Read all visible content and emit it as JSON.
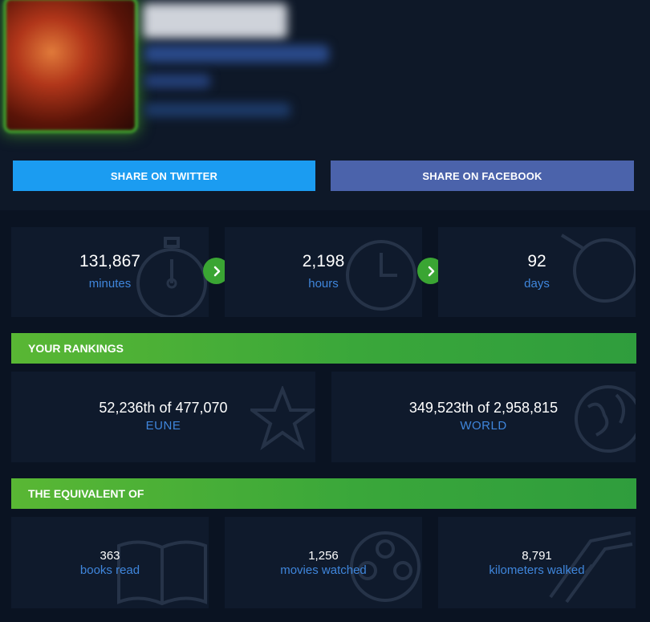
{
  "share": {
    "twitter_label": "SHARE ON TWITTER",
    "facebook_label": "SHARE ON FACEBOOK"
  },
  "time_stats": [
    {
      "value": "131,867",
      "unit": "minutes",
      "icon": "stopwatch-icon"
    },
    {
      "value": "2,198",
      "unit": "hours",
      "icon": "clock-icon"
    },
    {
      "value": "92",
      "unit": "days",
      "icon": "calendar-icon"
    }
  ],
  "rankings": {
    "title": "YOUR RANKINGS",
    "items": [
      {
        "value": "52,236th of 477,070",
        "label": "EUNE",
        "icon": "star-icon"
      },
      {
        "value": "349,523th of 2,958,815",
        "label": "WORLD",
        "icon": "globe-icon"
      }
    ]
  },
  "equivalent": {
    "title": "THE EQUIVALENT OF",
    "items": [
      {
        "value": "363",
        "label": "books read",
        "icon": "book-icon"
      },
      {
        "value": "1,256",
        "label": "movies watched",
        "icon": "film-reel-icon"
      },
      {
        "value": "8,791",
        "label": "kilometers walked",
        "icon": "road-icon"
      }
    ]
  },
  "colors": {
    "accent_green": "#3aa533",
    "label_blue": "#3f86dc",
    "twitter_blue": "#1b9cf1",
    "facebook_blue": "#4b63ab",
    "card_bg": "#0f1a2c",
    "page_bg": "#0a1322"
  }
}
